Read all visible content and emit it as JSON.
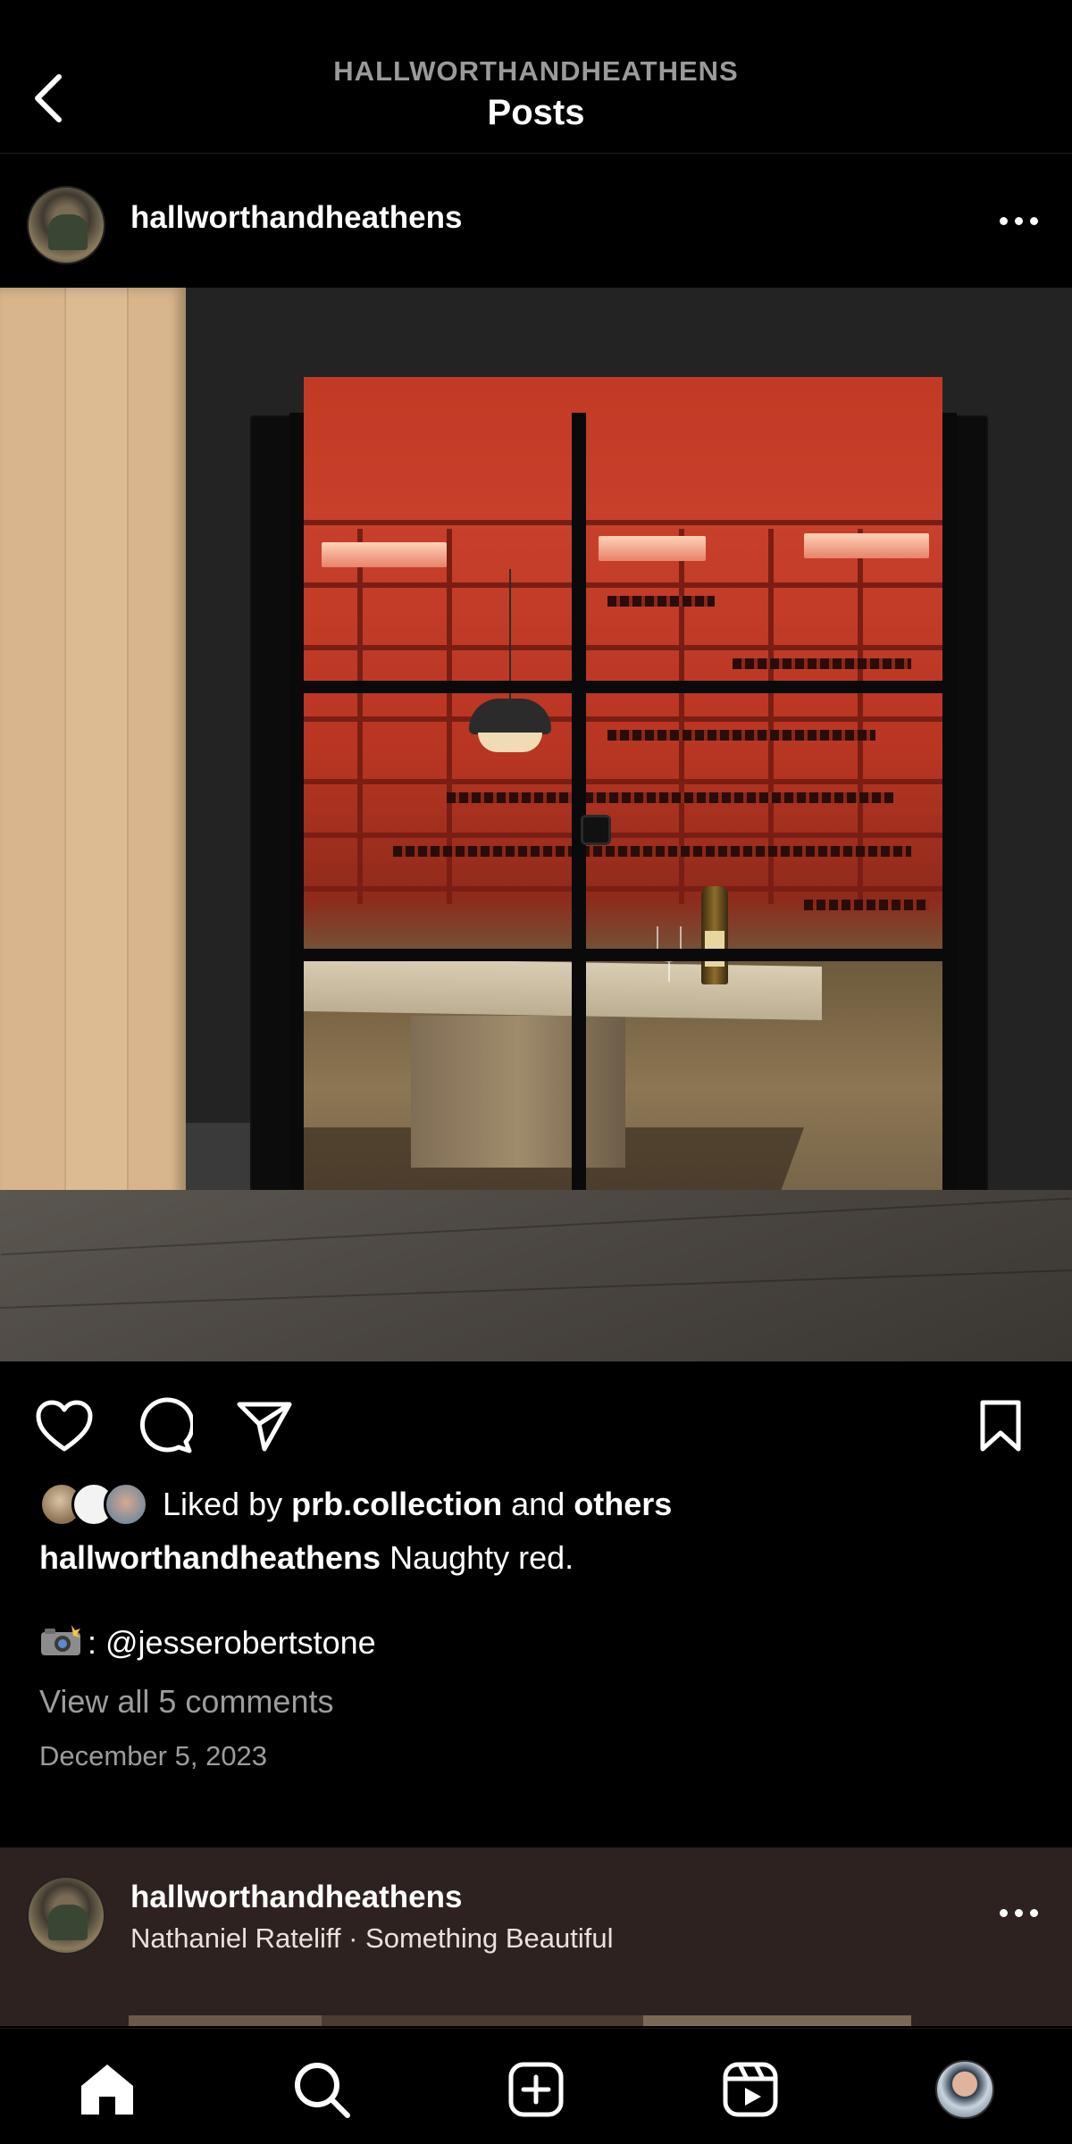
{
  "header": {
    "subtitle": "HALLWORTHANDHEATHENS",
    "title": "Posts"
  },
  "post": {
    "username": "hallworthandheathens",
    "likes": {
      "prefix": "Liked by",
      "user": "prb.collection",
      "joiner": "and",
      "others": "others"
    },
    "caption": {
      "username": "hallworthandheathens",
      "text": "Naughty red."
    },
    "credit": ": @jesserobertstone",
    "comments_link": "View all 5 comments",
    "date": "December 5, 2023",
    "actions": [
      "heart-icon",
      "comment-icon",
      "share-icon",
      "bookmark-icon"
    ]
  },
  "next_post": {
    "username": "hallworthandheathens",
    "music": "Nathaniel Rateliff · Something Beautiful"
  },
  "nav": [
    "home-icon",
    "search-icon",
    "create-icon",
    "reels-icon",
    "profile-avatar"
  ]
}
